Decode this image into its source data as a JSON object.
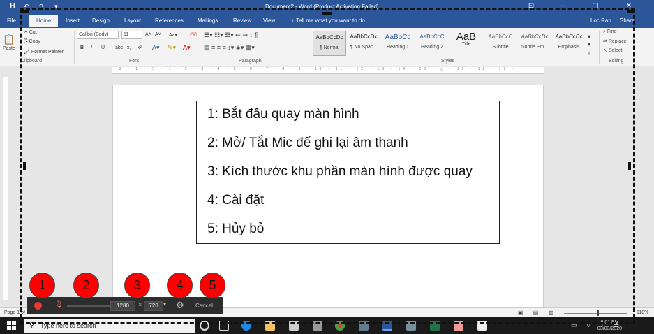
{
  "titlebar": {
    "app_letter": "H",
    "qat": "↶ ↷ ▾",
    "title": "Document2 - Word (Product Activation Failed)",
    "window_buttons": "⊡ – ▢ ✕"
  },
  "tabs": [
    {
      "label": "File"
    },
    {
      "label": "Home"
    },
    {
      "label": "Insert"
    },
    {
      "label": "Design"
    },
    {
      "label": "Layout"
    },
    {
      "label": "References"
    },
    {
      "label": "Mailings"
    },
    {
      "label": "Review"
    },
    {
      "label": "View"
    }
  ],
  "tell_me": "Tell me what you want to do...",
  "user": "Loc Ran",
  "share": "Share",
  "ribbon": {
    "clipboard": {
      "paste": "Paste",
      "cut": "Cut",
      "copy": "Copy",
      "format_painter": "Format Painter",
      "label": "Clipboard"
    },
    "font": {
      "name": "Calibri (Body)",
      "size": "11",
      "label": "Font",
      "bold": "B",
      "italic": "I",
      "underline": "U",
      "strike": "abc",
      "sub": "x₂",
      "sup": "x²",
      "grow": "A˄",
      "shrink": "A˅",
      "case": "Aa▾"
    },
    "paragraph": {
      "label": "Paragraph"
    },
    "styles": {
      "label": "Styles",
      "items": [
        {
          "preview": "AaBbCcDc",
          "name": "¶ Normal"
        },
        {
          "preview": "AaBbCcDc",
          "name": "¶ No Spac..."
        },
        {
          "preview": "AaBbCc",
          "name": "Heading 1"
        },
        {
          "preview": "AaBbCcC",
          "name": "Heading 2"
        },
        {
          "preview": "AaB",
          "name": "Title"
        },
        {
          "preview": "AaBbCcC",
          "name": "Subtitle"
        },
        {
          "preview": "AaBbCcDc",
          "name": "Subtle Em..."
        },
        {
          "preview": "AaBbCcDc",
          "name": "Emphasis"
        }
      ]
    },
    "editing": {
      "find": "Find",
      "replace": "Replace",
      "select": "Select",
      "label": "Editing"
    }
  },
  "ruler_text": "· 2 · 1 · ▽ · 1 · 2 · 3 · 4 · 5 · 6 · 7 · 8 · 9 · 10 · 11 · 12 · 13 · 14 · 15 · △ · 17 · 18 · 19 ·",
  "document": {
    "lines": [
      "1: Bắt đầu quay màn hình",
      "2: Mở/ Tắt Mic để ghi lại âm thanh",
      "3: Kích thước khu phần màn hình được quay",
      "4: Cài đặt",
      "5: Hủy bỏ"
    ]
  },
  "status": {
    "page": "Page 1 of 1",
    "zoom": "110%",
    "views": "▣ ▤ ▥"
  },
  "recorder": {
    "width": "1280",
    "times": "×",
    "height": "720",
    "dropdown": "▾",
    "cancel": "Cancel"
  },
  "badges": [
    "1",
    "2",
    "3",
    "4",
    "5"
  ],
  "taskbar": {
    "search_placeholder": "Type here to search",
    "time": "6:01 PM",
    "date": "03/03/2020",
    "tray": "⌃ ▭ ◊ ♪ ☰"
  },
  "colors": {
    "word_blue": "#2b579a",
    "record_red": "#e53935",
    "badge_red": "#ff0000",
    "toolbar": "#2d2d2d"
  }
}
